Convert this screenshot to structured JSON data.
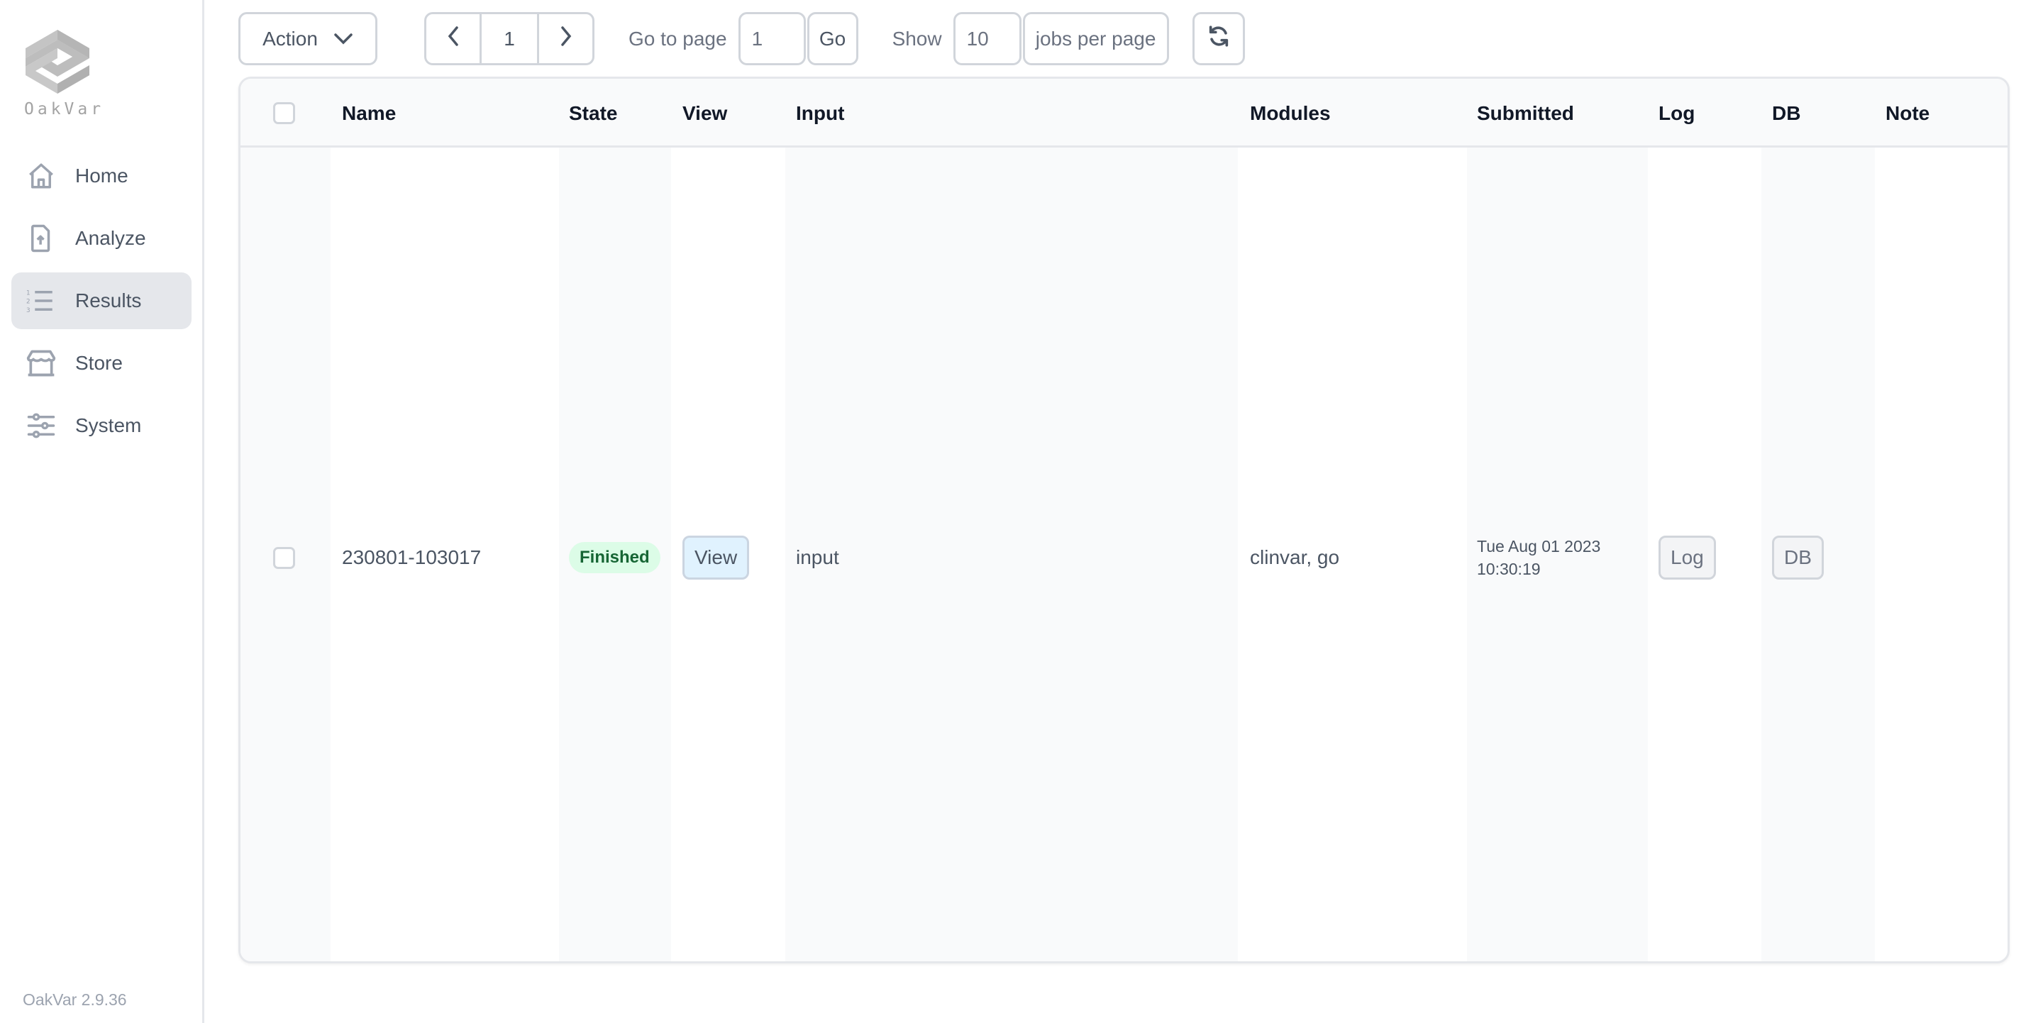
{
  "sidebar": {
    "logo_text": "OakVar",
    "items": [
      {
        "label": "Home",
        "icon": "home-icon",
        "active": false
      },
      {
        "label": "Analyze",
        "icon": "file-upload-icon",
        "active": false
      },
      {
        "label": "Results",
        "icon": "numbered-list-icon",
        "active": true
      },
      {
        "label": "Store",
        "icon": "storefront-icon",
        "active": false
      },
      {
        "label": "System",
        "icon": "sliders-icon",
        "active": false
      }
    ],
    "version": "OakVar 2.9.36"
  },
  "toolbar": {
    "action_label": "Action",
    "current_page": "1",
    "goto_label": "Go to page",
    "goto_value": "1",
    "go_label": "Go",
    "show_label": "Show",
    "per_page_value": "10",
    "per_page_suffix": "jobs per page"
  },
  "table": {
    "columns": [
      "Name",
      "State",
      "View",
      "Input",
      "Modules",
      "Submitted",
      "Log",
      "DB",
      "Note"
    ],
    "rows": [
      {
        "name": "230801-103017",
        "state": "Finished",
        "view_label": "View",
        "input": "input",
        "modules": "clinvar, go",
        "submitted_date": "Tue Aug 01 2023",
        "submitted_time": "10:30:19",
        "log_label": "Log",
        "db_label": "DB",
        "note": ""
      }
    ]
  },
  "colors": {
    "accent_active_nav": "#e5e7eb",
    "badge_finished_bg": "#dcfce7",
    "badge_finished_text": "#166534",
    "view_button_bg": "#e0f2fe"
  }
}
